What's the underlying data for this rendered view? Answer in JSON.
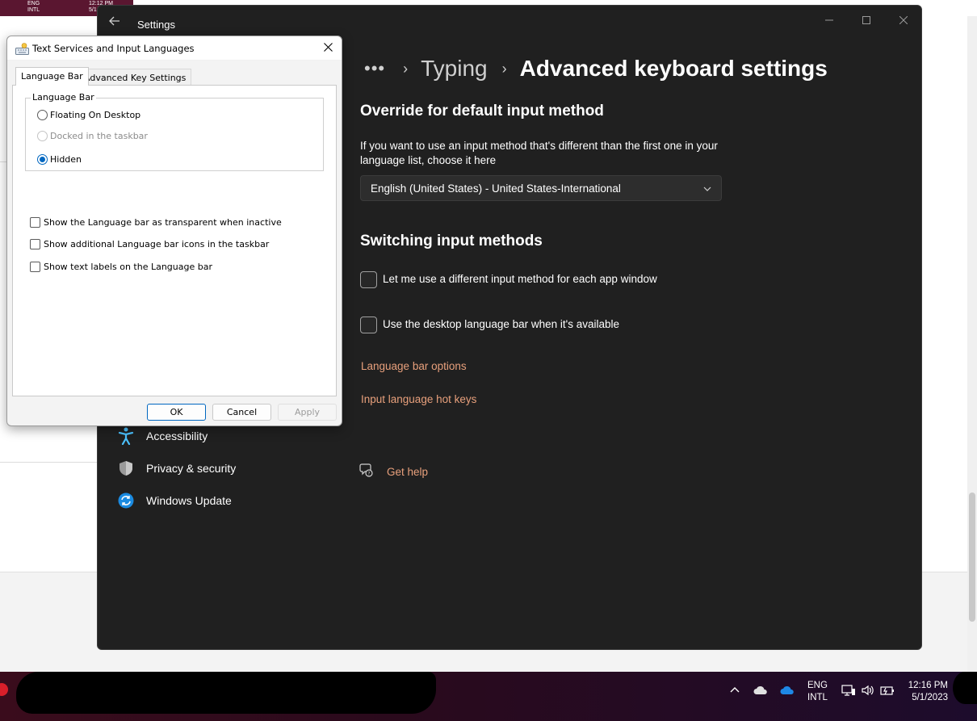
{
  "background": {
    "top_strip_lang": "ENG\nINTL",
    "top_strip_time": "12:12 PM",
    "top_strip_date": "5/1"
  },
  "settings": {
    "title": "Settings",
    "breadcrumb": {
      "more": "•••",
      "parent": "Typing",
      "current": "Advanced keyboard settings"
    },
    "override": {
      "heading": "Override for default input method",
      "description": "If you want to use an input method that's different than the first one in your language list, choose it here",
      "dropdown_value": "English (United States) - United States-International"
    },
    "switching": {
      "heading": "Switching input methods",
      "check_app_window": "Let me use a different input method for each app window",
      "check_desktop_bar": "Use the desktop language bar when it's available",
      "link_language_bar_options": "Language bar options",
      "link_hot_keys": "Input language hot keys"
    },
    "nav": {
      "accessibility": "Accessibility",
      "privacy": "Privacy & security",
      "windows_update": "Windows Update"
    },
    "get_help": "Get help"
  },
  "dialog": {
    "title": "Text Services and Input Languages",
    "tabs": [
      "Language Bar",
      "Advanced Key Settings"
    ],
    "group_title": "Language Bar",
    "radios": [
      {
        "label": "Floating On Desktop",
        "checked": false,
        "disabled": false
      },
      {
        "label": "Docked in the taskbar",
        "checked": false,
        "disabled": true
      },
      {
        "label": "Hidden",
        "checked": true,
        "disabled": false
      }
    ],
    "checks": [
      "Show the Language bar as transparent when inactive",
      "Show additional Language bar icons in the taskbar",
      "Show text labels on the Language bar"
    ],
    "buttons": {
      "ok": "OK",
      "cancel": "Cancel",
      "apply": "Apply"
    }
  },
  "taskbar": {
    "lang_line1": "ENG",
    "lang_line2": "INTL",
    "time": "12:16 PM",
    "date": "5/1/2023"
  },
  "colors": {
    "accent_link": "#e8a07c",
    "settings_bg": "#202020",
    "radio_selected": "#0067c0"
  }
}
